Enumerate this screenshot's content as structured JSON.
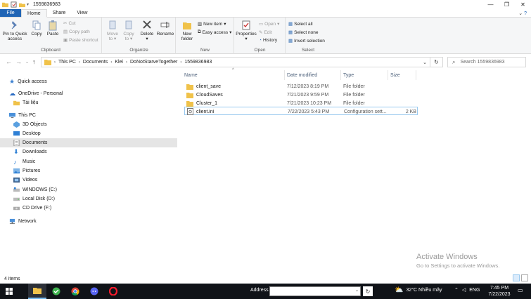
{
  "window": {
    "title": "1559836983",
    "minimize": "—",
    "maximize": "❐",
    "close": "✕"
  },
  "tabs": {
    "file": "File",
    "home": "Home",
    "share": "Share",
    "view": "View"
  },
  "ribbon": {
    "clipboard": {
      "label": "Clipboard",
      "pin": "Pin to Quick access",
      "pin_l1": "Pin to Quick",
      "pin_l2": "access",
      "copy": "Copy",
      "paste": "Paste",
      "cut": "Cut",
      "copy_path": "Copy path",
      "paste_shortcut": "Paste shortcut"
    },
    "organize": {
      "label": "Organize",
      "move_l1": "Move",
      "move_l2": "to",
      "copy_l1": "Copy",
      "copy_l2": "to",
      "delete": "Delete",
      "rename": "Rename"
    },
    "new": {
      "label": "New",
      "new_folder_l1": "New",
      "new_folder_l2": "folder",
      "new_item": "New item",
      "easy_access": "Easy access"
    },
    "open": {
      "label": "Open",
      "properties": "Properties",
      "open": "Open",
      "edit": "Edit",
      "history": "History"
    },
    "select": {
      "label": "Select",
      "select_all": "Select all",
      "select_none": "Select none",
      "invert": "Invert selection"
    }
  },
  "address": {
    "crumbs": [
      "This PC",
      "Documents",
      "Klei",
      "DoNotStarveTogether",
      "1559836983"
    ],
    "search_placeholder": "Search 1559836983"
  },
  "nav": {
    "quick_access": "Quick access",
    "onedrive": "OneDrive - Personal",
    "tai_lieu": "Tài liệu",
    "this_pc": "This PC",
    "objects3d": "3D Objects",
    "desktop": "Desktop",
    "documents": "Documents",
    "downloads": "Downloads",
    "music": "Music",
    "pictures": "Pictures",
    "videos": "Videos",
    "windows_c": "WINDOWS (C:)",
    "local_d": "Local Disk (D:)",
    "cd_f": "CD Drive (F:)",
    "network": "Network"
  },
  "columns": {
    "name": "Name",
    "date": "Date modified",
    "type": "Type",
    "size": "Size"
  },
  "files": [
    {
      "name": "client_save",
      "date": "7/12/2023 8:19 PM",
      "type": "File folder",
      "size": ""
    },
    {
      "name": "CloudSaves",
      "date": "7/21/2023 9:59 PM",
      "type": "File folder",
      "size": ""
    },
    {
      "name": "Cluster_1",
      "date": "7/21/2023 10:23 PM",
      "type": "File folder",
      "size": ""
    },
    {
      "name": "client.ini",
      "date": "7/22/2023 5:43 PM",
      "type": "Configuration sett...",
      "size": "2 KB"
    }
  ],
  "status": {
    "count": "4 items"
  },
  "watermark": {
    "line1": "Activate Windows",
    "line2": "Go to Settings to activate Windows."
  },
  "taskbar": {
    "address_label": "Address",
    "weather": "32°C  Nhiều mây",
    "lang": "ENG",
    "time": "7:45 PM",
    "date": "7/22/2023"
  },
  "colors": {
    "accent": "#1f64b5",
    "folder": "#f0c24a",
    "taskbar": "#101318"
  }
}
